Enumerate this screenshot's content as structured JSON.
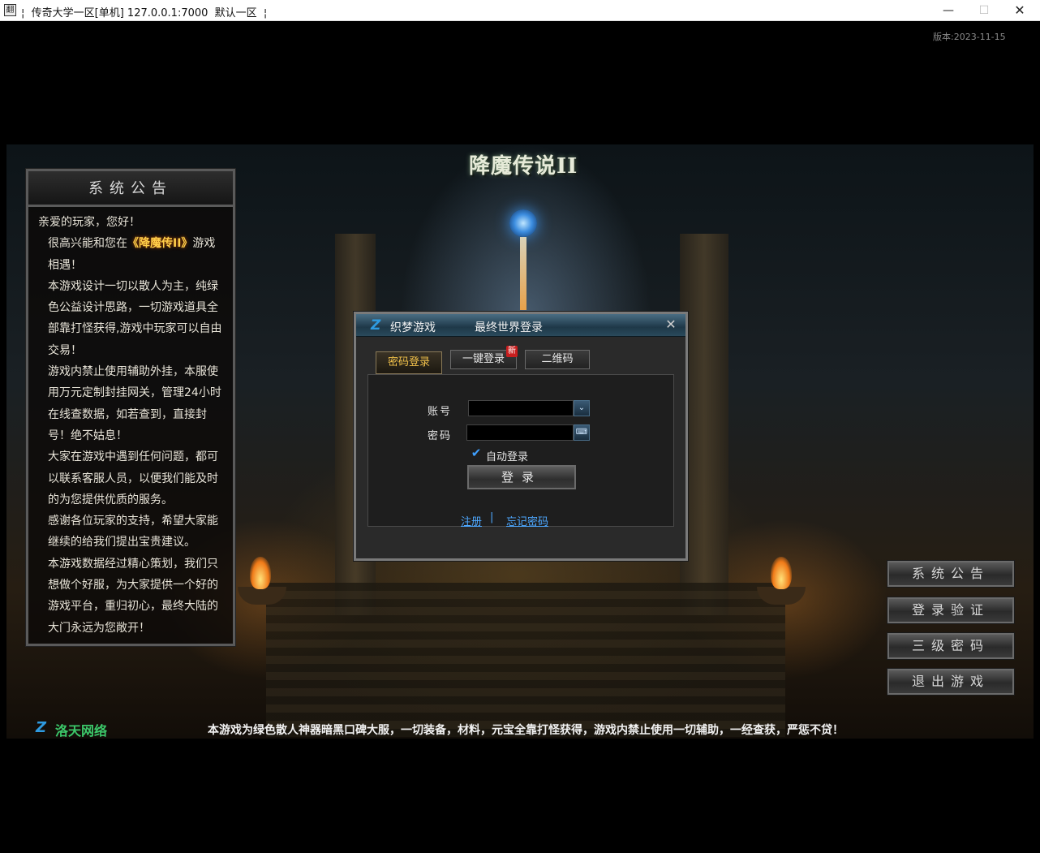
{
  "window": {
    "icon_glyph": "翻",
    "title": "¦  传奇大学一区[单机] 127.0.0.1:7000  默认一区  ¦",
    "minimize_glyph": "—",
    "maximize_glyph": "☐",
    "close_glyph": "✕"
  },
  "version": "版本:2023-11-15",
  "game_title": "降魔传说II",
  "notice": {
    "header": "系统公告",
    "lines": [
      "亲爱的玩家，您好！",
      "很高兴能和您在",
      "《降魔传II》",
      "游戏相遇！",
      "本游戏设计一切以散人为主，纯绿色公益设计思路，一切游戏道具全部靠打怪获得,游戏中玩家可以自由交易！",
      "游戏内禁止使用辅助外挂，本服使用万元定制封挂网关，管理24小时在线查数据，如若查到，直接封号！绝不姑息！",
      "大家在游戏中遇到任何问题，都可以联系客服人员，以便我们能及时的为您提供优质的服务。",
      "感谢各位玩家的支持，希望大家能继续的给我们提出宝贵建议。",
      "本游戏数据经过精心策划，我们只想做个好服，为大家提供一个好的游戏平台，重归初心，最终大陆的大门永远为您敞开！"
    ]
  },
  "login": {
    "logo_glyph": "Z",
    "brand": "织梦游戏",
    "server": "最终世界登录",
    "close_glyph": "✕",
    "tabs": [
      "密码登录",
      "一键登录",
      "二维码"
    ],
    "new_badge": "新",
    "account_label": "账号",
    "password_label": "密码",
    "account_value": "",
    "password_value": "",
    "account_dropdown_glyph": "⌄",
    "password_keyboard_glyph": "⌨",
    "remember_check_glyph": "✔",
    "remember_label": "自动登录",
    "login_button": "登录",
    "register_link": "注册",
    "separator": "|",
    "forgot_link": "忘记密码"
  },
  "side_buttons": [
    "系统公告",
    "登录验证",
    "三级密码",
    "退出游戏"
  ],
  "footer": {
    "logo_glyph": "Z",
    "logo_text": "洛天网络",
    "notice": "本游戏为绿色散人神器暗黑口碑大服，一切装备，材料，元宝全靠打怪获得，游戏内禁止使用一切辅助，一经查获，严惩不贷！"
  },
  "colors": {
    "accent_blue": "#2e9ae0",
    "link_blue": "#4ea8ff",
    "highlight_gold": "#ffcf4a",
    "footer_green": "#3cc86a"
  }
}
